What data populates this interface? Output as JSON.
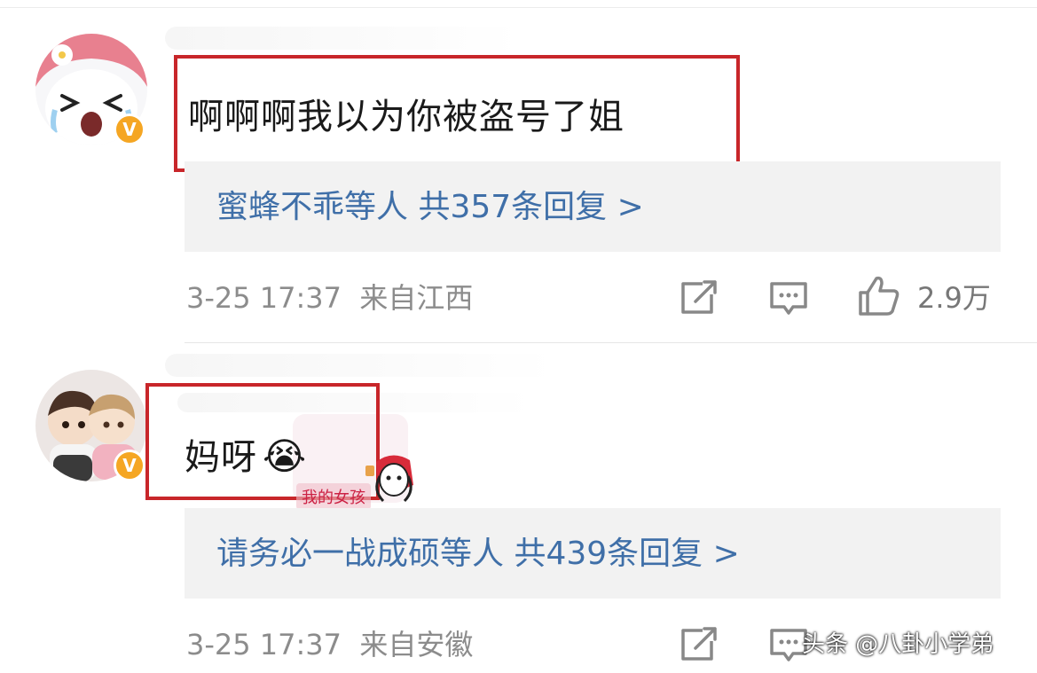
{
  "comments": [
    {
      "text": "啊啊啊我以为你被盗号了姐",
      "verified_badge": "V",
      "reply_summary": "蜜蜂不乖等人 共357条回复 >",
      "time": "3-25 17:37",
      "location": "来自江西",
      "likes": "2.9万"
    },
    {
      "text": "妈呀",
      "emoji": "😭",
      "verified_badge": "V",
      "sticker_caption": "我的女孩",
      "reply_summary": "请务必一战成硕等人 共439条回复 >",
      "time": "3-25 17:37",
      "location": "来自安徽"
    }
  ],
  "icons": [
    "share-icon",
    "comment-icon",
    "like-icon"
  ],
  "colors": {
    "highlight_box": "#c8262a",
    "reply_link": "#3f6fa8",
    "meta_text": "#8c8c8c",
    "verified_badge": "#f5a623"
  },
  "watermark": "头条 @八卦小学弟"
}
